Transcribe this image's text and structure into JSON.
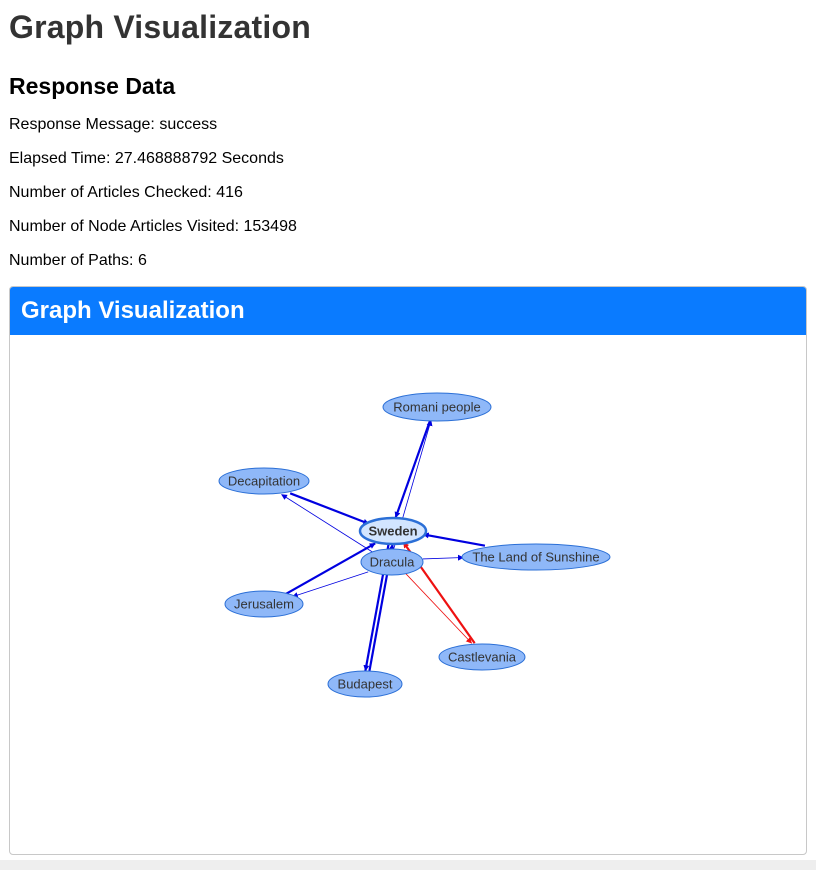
{
  "page": {
    "title": "Graph Visualization",
    "response_heading": "Response Data",
    "stats": [
      {
        "label": "Response Message: ",
        "value": "success"
      },
      {
        "label": "Elapsed Time: ",
        "value": "27.468888792 Seconds"
      },
      {
        "label": "Number of Articles Checked: ",
        "value": "416"
      },
      {
        "label": "Number of Node Articles Visited: ",
        "value": "153498"
      },
      {
        "label": "Number of Paths: ",
        "value": "6"
      }
    ]
  },
  "card": {
    "header": "Graph Visualization"
  },
  "colors": {
    "header_bg": "#0a7bff",
    "node_fill": "#8fb8f8",
    "center_node_fill": "#d2e5ff",
    "node_stroke": "#2b6fd6",
    "edge_blue": "#0000e0",
    "edge_red": "#ee1111"
  },
  "graph": {
    "nodes": [
      {
        "id": "sweden",
        "label": "Sweden",
        "center": true
      },
      {
        "id": "dracula",
        "label": "Dracula"
      },
      {
        "id": "romani",
        "label": "Romani people"
      },
      {
        "id": "decapitation",
        "label": "Decapitation"
      },
      {
        "id": "landofsunshine",
        "label": "The Land of Sunshine"
      },
      {
        "id": "jerusalem",
        "label": "Jerusalem"
      },
      {
        "id": "castlevania",
        "label": "Castlevania"
      },
      {
        "id": "budapest",
        "label": "Budapest"
      }
    ],
    "edges": [
      {
        "from": "romani",
        "to": "sweden",
        "color": "blue",
        "weight": "thick"
      },
      {
        "from": "dracula",
        "to": "romani",
        "color": "blue",
        "weight": "thin"
      },
      {
        "from": "decapitation",
        "to": "sweden",
        "color": "blue",
        "weight": "thick"
      },
      {
        "from": "dracula",
        "to": "decapitation",
        "color": "blue",
        "weight": "thin"
      },
      {
        "from": "landofsunshine",
        "to": "sweden",
        "color": "blue",
        "weight": "thick"
      },
      {
        "from": "dracula",
        "to": "landofsunshine",
        "color": "blue",
        "weight": "thin"
      },
      {
        "from": "jerusalem",
        "to": "sweden",
        "color": "blue",
        "weight": "thick"
      },
      {
        "from": "dracula",
        "to": "jerusalem",
        "color": "blue",
        "weight": "thin"
      },
      {
        "from": "budapest",
        "to": "sweden",
        "color": "blue",
        "weight": "thick"
      },
      {
        "from": "sweden",
        "to": "budapest",
        "color": "blue",
        "weight": "thick"
      },
      {
        "from": "castlevania",
        "to": "sweden",
        "color": "red",
        "weight": "thick"
      },
      {
        "from": "dracula",
        "to": "castlevania",
        "color": "red",
        "weight": "thin"
      }
    ]
  }
}
